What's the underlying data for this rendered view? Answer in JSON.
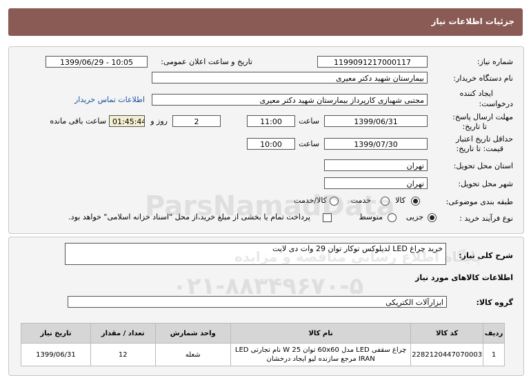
{
  "header": {
    "title": "جزئیات اطلاعات نیاز"
  },
  "form": {
    "need_number_label": "شماره نیاز:",
    "need_number": "1199091217000117",
    "announce_label": "تاریخ و ساعت اعلان عمومی:",
    "announce_value": "1399/06/29 - 10:05",
    "buyer_label": "نام دستگاه خریدار:",
    "buyer_value": "بیمارستان شهید دکتر معیری",
    "creator_label_1": "ایجاد کننده",
    "creator_label_2": "درخواست:",
    "creator_value": "مجتبی  شهبازی کارپرداز بیمارستان شهید دکتر معیری",
    "contact_link": "اطلاعات تماس خریدار",
    "deadline_label_1": "مهلت ارسال پاسخ:",
    "deadline_label_2": "تا تاریخ:",
    "deadline_date": "1399/06/31",
    "time_label": "ساعت",
    "deadline_time": "11:00",
    "days_value": "2",
    "days_label": "روز و",
    "remaining_time": "01:45:44",
    "remaining_label": "ساعت باقی مانده",
    "validity_label_1": "حداقل تاریخ اعتبار",
    "validity_label_2": "قیمت: تا تاریخ:",
    "validity_date": "1399/07/30",
    "validity_time_label": "ساعت",
    "validity_time": "10:00",
    "province_label": "استان محل تحویل:",
    "province_value": "تهران",
    "city_label": "شهر محل تحویل:",
    "city_value": "تهران",
    "category_label": "طبقه بندی موضوعی:",
    "category_options": [
      "کالا",
      "خدمت",
      "کالا/خدمت"
    ],
    "process_label": "نوع فرآیند خرید :",
    "process_options": [
      "جزیی",
      "متوسط"
    ],
    "payment_note": "پرداخت تمام یا بخشی از مبلغ خرید،از محل \"اسناد خزانه اسلامی\" خواهد بود."
  },
  "desc": {
    "label": "شرح کلی نیاز:",
    "value": "خرید چراغ LED  لدیلوکس توکار توان 29 وات دی لایت"
  },
  "goods": {
    "section_title": "اطلاعات کالاهای مورد نیاز",
    "group_label": "گروه کالا:",
    "group_value": "ابزارآلات الکتریکی"
  },
  "table": {
    "headers": [
      "ردیف",
      "کد کالا",
      "نام کالا",
      "واحد شمارش",
      "تعداد / مقدار",
      "تاریخ نیاز"
    ],
    "rows": [
      {
        "index": "1",
        "code": "2282120447070003",
        "name": "چراغ سقفی LED مدل 60x60 توان 25 W نام تجارتی LED IRAN مرجع سازنده لیو ایجاد درخشان",
        "unit": "شعله",
        "qty": "12",
        "date": "1399/06/31"
      }
    ]
  },
  "watermark": {
    "brand": "ParsNamadData",
    "subtitle": "پایگاه اطلاع رسانی مناقصه و مزایده",
    "phone": "۰۲۱-۸۸۳۴۹۶۷۰-۵"
  }
}
